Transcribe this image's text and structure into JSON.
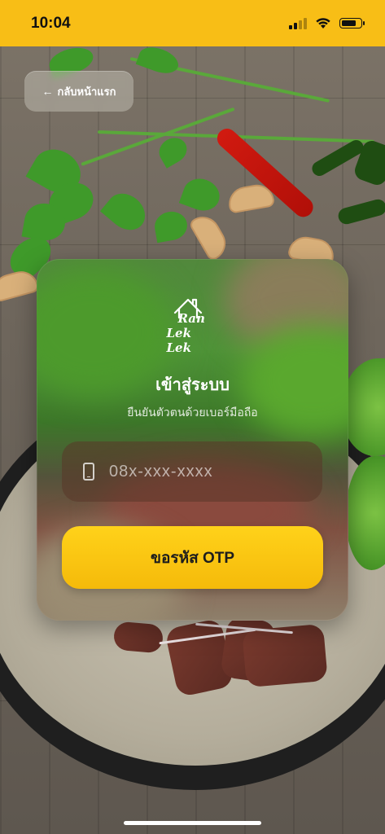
{
  "status_bar": {
    "time": "10:04",
    "battery_level": 0.7,
    "wifi_icon": "wifi-icon",
    "signal_icon": "cellular-signal-icon"
  },
  "back_button": {
    "label": "กลับหน้าแรก",
    "arrow": "←"
  },
  "logo": {
    "line1": "Ran",
    "line2": "Lek Lek"
  },
  "login": {
    "title": "เข้าสู่ระบบ",
    "subtitle": "ยืนยันตัวตนด้วยเบอร์มือถือ",
    "phone_placeholder": "08x-xxx-xxxx",
    "phone_value": "",
    "submit_label": "ขอรหัส OTP"
  },
  "colors": {
    "brand_yellow": "#F8BE16",
    "button_yellow": "#FFD21A"
  }
}
